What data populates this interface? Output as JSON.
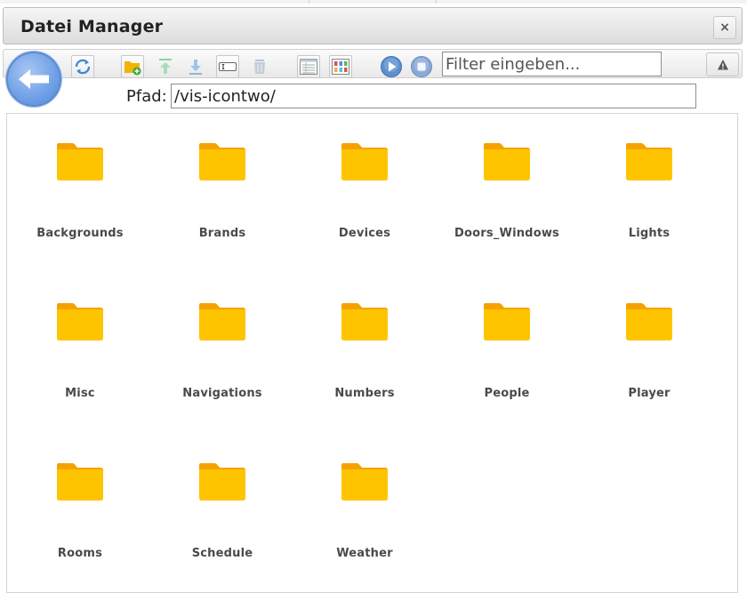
{
  "window": {
    "title": "Datei Manager",
    "close_label": "×"
  },
  "toolbar": {
    "tools": [
      {
        "name": "refresh-icon"
      },
      {
        "name": "new-folder-icon"
      },
      {
        "name": "upload-icon"
      },
      {
        "name": "download-icon"
      },
      {
        "name": "rename-icon"
      },
      {
        "name": "delete-icon"
      },
      {
        "name": "table-view-icon"
      },
      {
        "name": "icon-view-icon"
      },
      {
        "name": "play-icon"
      },
      {
        "name": "stop-icon"
      }
    ],
    "filter_placeholder": "Filter eingeben...",
    "warn_label": "!"
  },
  "path": {
    "label": "Pfad:",
    "value": "/vis-icontwo/"
  },
  "folders": [
    {
      "name": "Backgrounds"
    },
    {
      "name": "Brands"
    },
    {
      "name": "Devices"
    },
    {
      "name": "Doors_Windows"
    },
    {
      "name": "Lights"
    },
    {
      "name": "Misc"
    },
    {
      "name": "Navigations"
    },
    {
      "name": "Numbers"
    },
    {
      "name": "People"
    },
    {
      "name": "Player"
    },
    {
      "name": "Rooms"
    },
    {
      "name": "Schedule"
    },
    {
      "name": "Weather"
    }
  ],
  "colors": {
    "folder_body": "#ffc400",
    "folder_tab": "#f5a200",
    "back_button": "#6f9fe6"
  }
}
